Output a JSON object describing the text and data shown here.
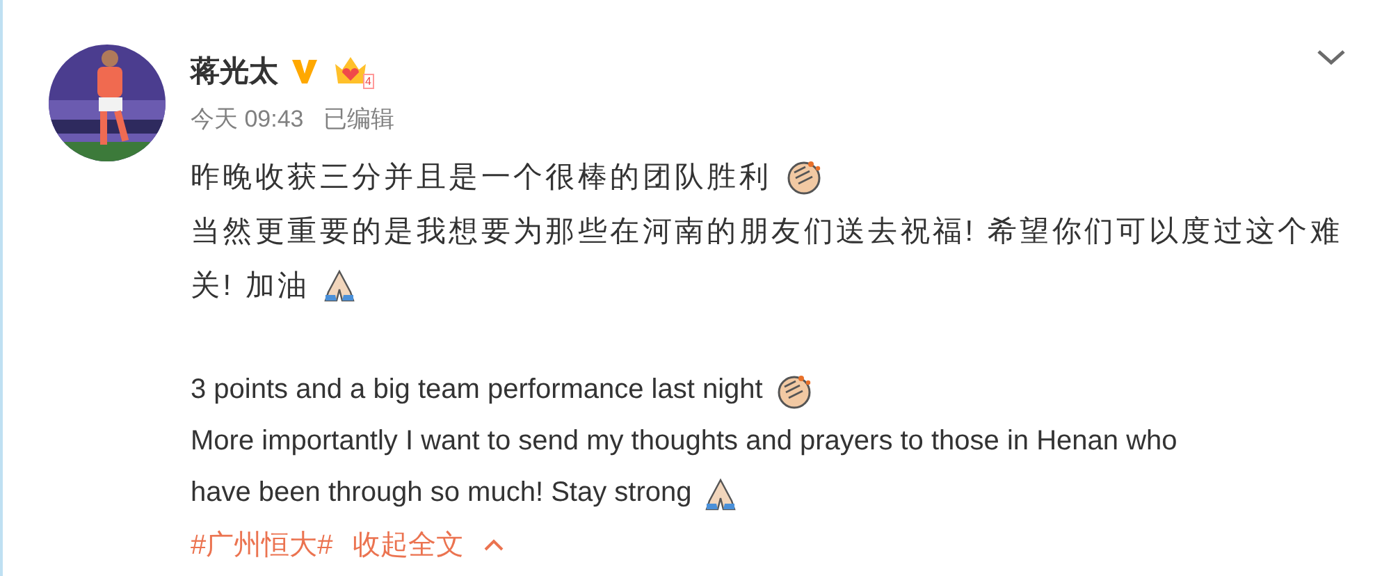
{
  "post": {
    "author": "蒋光太",
    "verified": true,
    "vip_level": "4",
    "time": "今天 09:43",
    "edited": "已编辑",
    "lines": [
      {
        "kind": "zh",
        "text": "昨晚收获三分并且是一个很棒的团队胜利",
        "clap_emoji": true
      },
      {
        "kind": "zh",
        "text": "当然更重要的是我想要为那些在河南的朋友们送去祝福! 希望你们可以度过这个难"
      },
      {
        "kind": "zh",
        "text": "关! 加油",
        "pray_emoji": true
      },
      {
        "kind": "blank"
      },
      {
        "kind": "en",
        "text": "3 points and a big team performance last night",
        "clap_emoji": true
      },
      {
        "kind": "en",
        "text": "More importantly I want to send my thoughts and prayers to those in Henan who"
      },
      {
        "kind": "en",
        "text": "have been through so much! Stay strong",
        "pray_emoji": true
      }
    ],
    "topic": "#广州恒大#",
    "collapse": "收起全文"
  }
}
